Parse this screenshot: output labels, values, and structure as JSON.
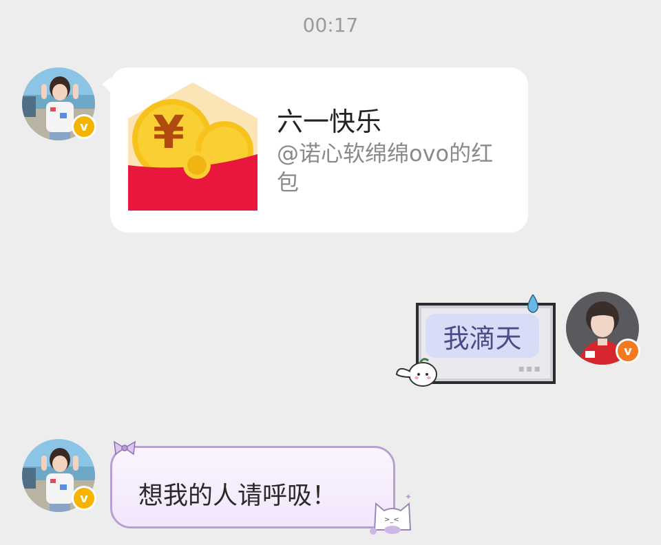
{
  "timestamp": "00:17",
  "messages": {
    "red_packet": {
      "title": "六一快乐",
      "subtitle": "@诺心软绵绵ovo的红包",
      "currency_symbol": "¥"
    },
    "reply": {
      "text": "我滴天"
    },
    "third": {
      "text": "想我的人请呼吸！"
    }
  },
  "badges": {
    "left_avatar_badge": "v",
    "right_avatar_badge": "v"
  },
  "colors": {
    "background": "#ededed",
    "bubble_white": "#ffffff",
    "envelope_red": "#e8173c",
    "coin_gold": "#f6c21a",
    "badge_gold": "#f6b400",
    "badge_orange": "#f47a20",
    "pixel_text": "#4a4d87",
    "purple_border": "#b89fd2"
  }
}
